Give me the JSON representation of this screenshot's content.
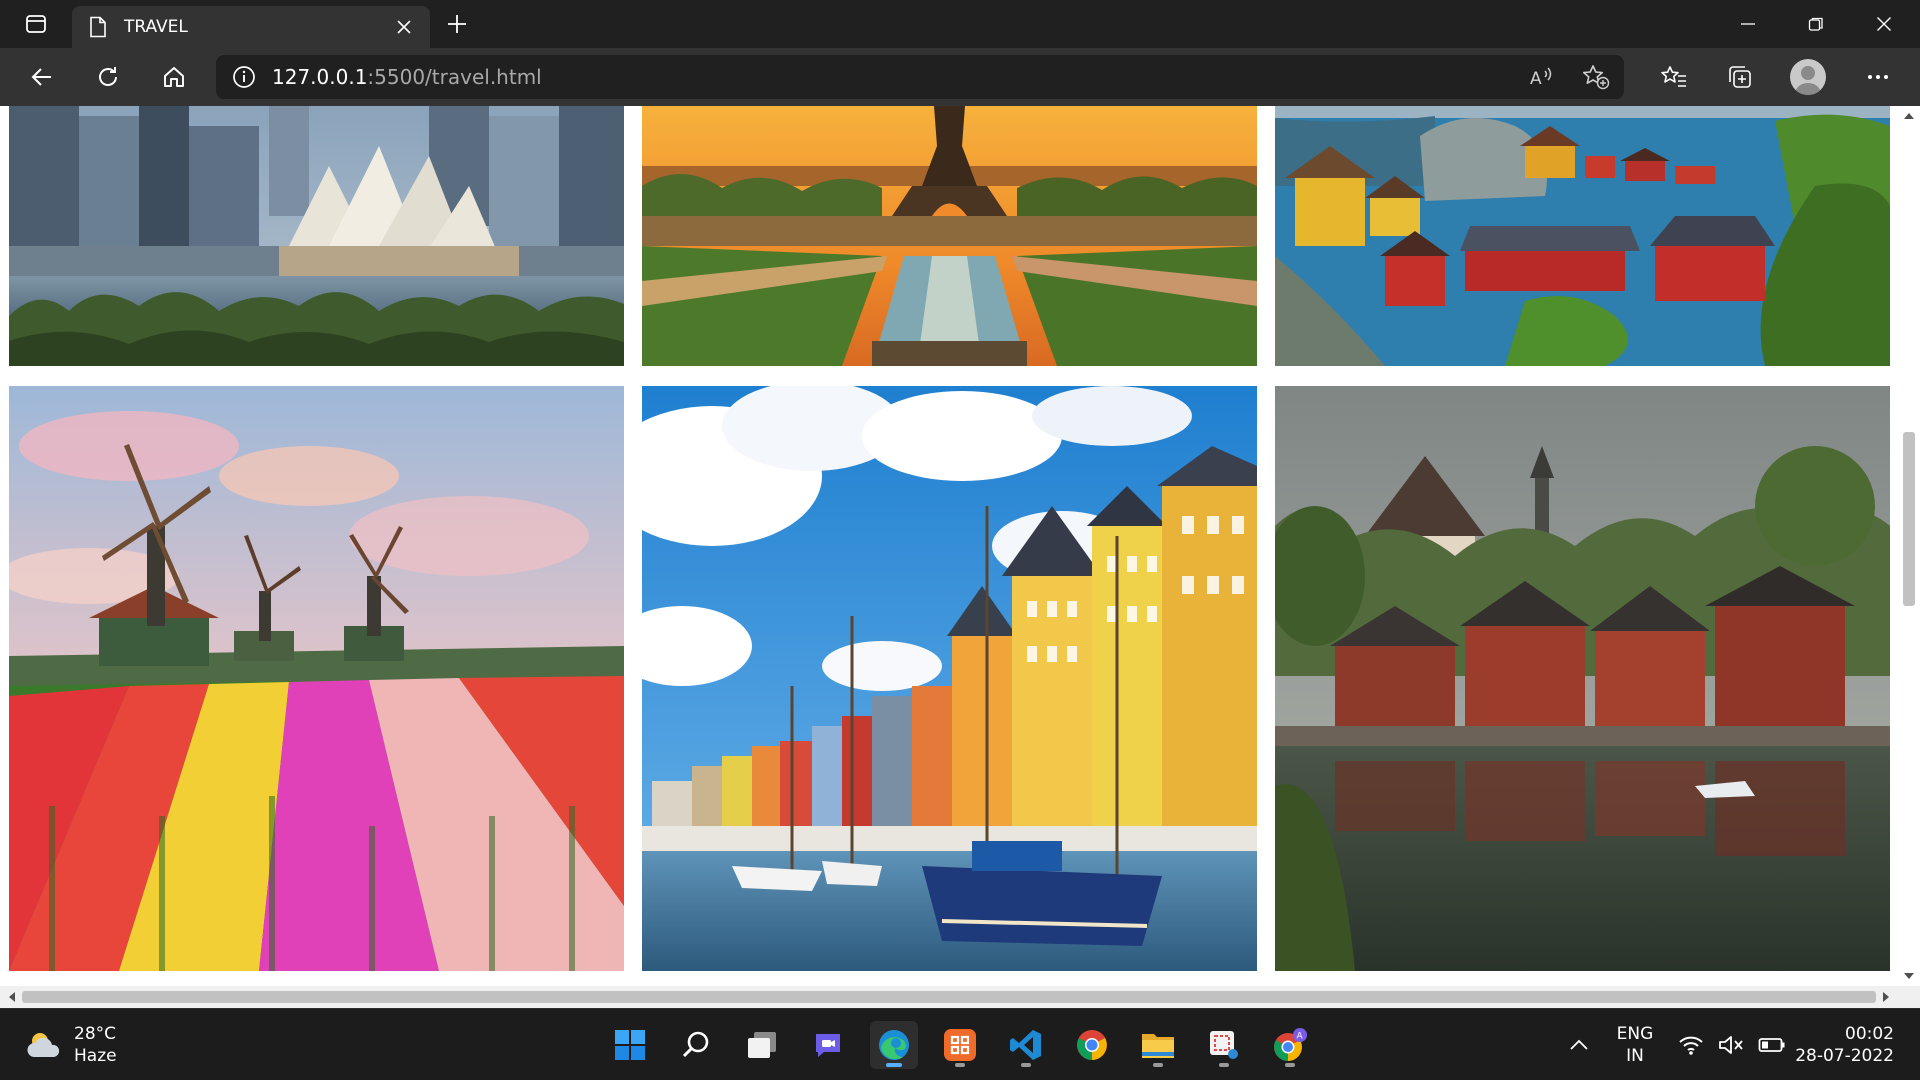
{
  "browser": {
    "tab_title": "TRAVEL",
    "url_host": "127.0.0.1",
    "url_rest": ":5500/travel.html",
    "read_aloud_label": "A",
    "icons": {
      "tab_actions": "tab-actions-icon",
      "page": "page-icon",
      "close_tab": "close-icon",
      "new_tab": "plus-icon",
      "minimize": "minimize-icon",
      "restore": "restore-icon",
      "close_window": "close-icon",
      "back": "back-arrow-icon",
      "refresh": "refresh-icon",
      "home": "home-icon",
      "site_info": "info-icon",
      "read_aloud": "read-aloud-icon",
      "add_favorite": "star-plus-icon",
      "favorites": "favorites-icon",
      "collections": "collections-icon",
      "profile": "avatar",
      "menu": "more-icon"
    }
  },
  "gallery": {
    "photos": [
      {
        "name": "sydney-opera-house",
        "palette": [
          "#6f8aa6",
          "#c9c4b8",
          "#4f6b3c"
        ]
      },
      {
        "name": "eiffel-tower-paris",
        "palette": [
          "#f2a23a",
          "#5a4a2c",
          "#3f6a2a"
        ]
      },
      {
        "name": "norway-village",
        "palette": [
          "#3d86b8",
          "#c7302c",
          "#e6b325"
        ]
      },
      {
        "name": "netherlands-windmills-tulips",
        "palette": [
          "#e8b9c3",
          "#d9362e",
          "#e6cf33"
        ]
      },
      {
        "name": "copenhagen-nyhavn",
        "palette": [
          "#2f86cf",
          "#f0b331",
          "#1f3a73"
        ]
      },
      {
        "name": "porvoo-finland",
        "palette": [
          "#8d938f",
          "#9b3a2a",
          "#4b5a3a"
        ]
      }
    ]
  },
  "taskbar": {
    "weather_temp": "28°C",
    "weather_desc": "Haze",
    "lang_top": "ENG",
    "lang_bottom": "IN",
    "time": "00:02",
    "date": "28-07-2022",
    "apps": [
      "windows-start-icon",
      "search-icon",
      "task-view-icon",
      "chat-icon",
      "edge-icon",
      "app-icon",
      "vscode-icon",
      "chrome-icon",
      "file-explorer-icon",
      "snipping-tool-icon",
      "chrome-profile-icon"
    ]
  },
  "colors": {
    "chrome_dark": "#202020",
    "chrome_mid": "#333333",
    "taskbar": "#1c1c1c",
    "accent_blue": "#58b0ff"
  }
}
